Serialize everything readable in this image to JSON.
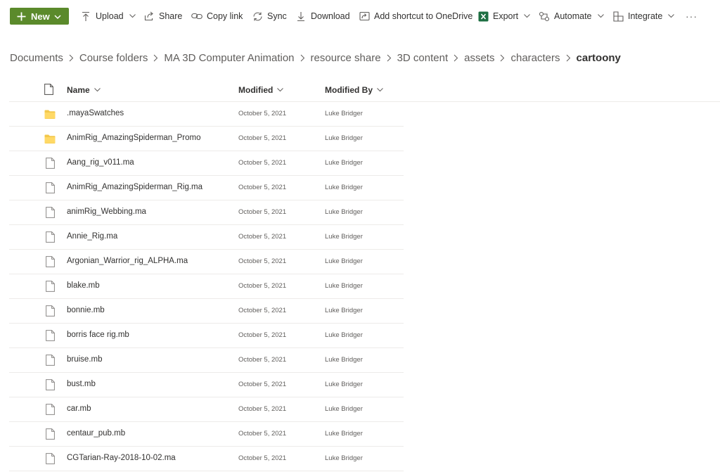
{
  "toolbar": {
    "new_label": "New",
    "upload_label": "Upload",
    "share_label": "Share",
    "copy_link_label": "Copy link",
    "sync_label": "Sync",
    "download_label": "Download",
    "shortcut_label": "Add shortcut to OneDrive",
    "export_label": "Export",
    "automate_label": "Automate",
    "integrate_label": "Integrate",
    "more_label": "···",
    "accent_color": "#5b8a2b"
  },
  "breadcrumb": [
    "Documents",
    "Course folders",
    "MA 3D Computer Animation",
    "resource share",
    "3D content",
    "assets",
    "characters",
    "cartoony"
  ],
  "columns": {
    "name": "Name",
    "modified": "Modified",
    "modified_by": "Modified By"
  },
  "rows": [
    {
      "type": "folder",
      "name": ".mayaSwatches",
      "modified": "October 5, 2021",
      "modified_by": "Luke Bridger"
    },
    {
      "type": "folder",
      "name": "AnimRig_AmazingSpiderman_Promo",
      "modified": "October 5, 2021",
      "modified_by": "Luke Bridger"
    },
    {
      "type": "file",
      "name": "Aang_rig_v011.ma",
      "modified": "October 5, 2021",
      "modified_by": "Luke Bridger"
    },
    {
      "type": "file",
      "name": "AnimRig_AmazingSpiderman_Rig.ma",
      "modified": "October 5, 2021",
      "modified_by": "Luke Bridger"
    },
    {
      "type": "file",
      "name": "animRig_Webbing.ma",
      "modified": "October 5, 2021",
      "modified_by": "Luke Bridger"
    },
    {
      "type": "file",
      "name": "Annie_Rig.ma",
      "modified": "October 5, 2021",
      "modified_by": "Luke Bridger"
    },
    {
      "type": "file",
      "name": "Argonian_Warrior_rig_ALPHA.ma",
      "modified": "October 5, 2021",
      "modified_by": "Luke Bridger"
    },
    {
      "type": "file",
      "name": "blake.mb",
      "modified": "October 5, 2021",
      "modified_by": "Luke Bridger"
    },
    {
      "type": "file",
      "name": "bonnie.mb",
      "modified": "October 5, 2021",
      "modified_by": "Luke Bridger"
    },
    {
      "type": "file",
      "name": "borris face rig.mb",
      "modified": "October 5, 2021",
      "modified_by": "Luke Bridger"
    },
    {
      "type": "file",
      "name": "bruise.mb",
      "modified": "October 5, 2021",
      "modified_by": "Luke Bridger"
    },
    {
      "type": "file",
      "name": "bust.mb",
      "modified": "October 5, 2021",
      "modified_by": "Luke Bridger"
    },
    {
      "type": "file",
      "name": "car.mb",
      "modified": "October 5, 2021",
      "modified_by": "Luke Bridger"
    },
    {
      "type": "file",
      "name": "centaur_pub.mb",
      "modified": "October 5, 2021",
      "modified_by": "Luke Bridger"
    },
    {
      "type": "file",
      "name": "CGTarian-Ray-2018-10-02.ma",
      "modified": "October 5, 2021",
      "modified_by": "Luke Bridger"
    }
  ]
}
